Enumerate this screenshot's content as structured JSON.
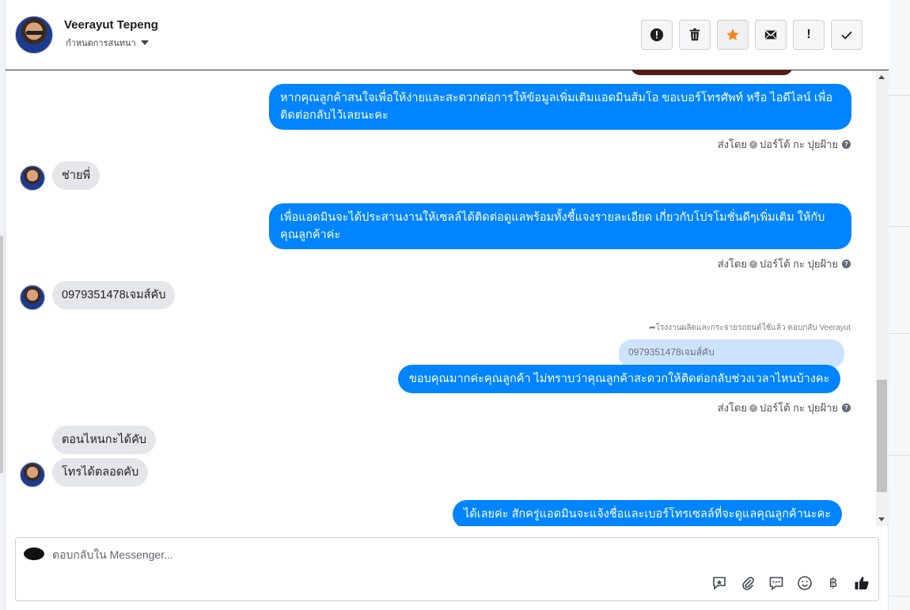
{
  "contact": {
    "name": "Veerayut Tepeng",
    "assign_label": "กำหนดการสนทนา"
  },
  "header_actions": [
    {
      "name": "spam-icon",
      "symbol": "!"
    },
    {
      "name": "trash-icon",
      "symbol": ""
    },
    {
      "name": "star-icon",
      "symbol": "★",
      "color": "#f5821f"
    },
    {
      "name": "mail-icon",
      "symbol": ""
    },
    {
      "name": "follow-up-icon",
      "symbol": "!"
    },
    {
      "name": "done-icon",
      "symbol": ""
    }
  ],
  "messages": [
    {
      "id": "m1",
      "dir": "out",
      "text": "หากคุณลูกค้าสนใจเพื่อให้ง่ายและสะดวกต่อการให้ข้อมูลเพิ่มเติมแอดมินส้มโอ ขอเบอร์โทรศัพท์ หรือ ไอดีไลน์ เพื่อติดต่อกลับไว้เลยนะคะ"
    },
    {
      "id": "m2",
      "dir": "in",
      "text": "ช่ายพี่"
    },
    {
      "id": "m3",
      "dir": "out",
      "text": "เพื่อแอดมินจะได้ประสานงานให้เซลล์ได้ติดต่อดูแลพร้อมทั้งชี้แจงรายละเอียด เกี่ยวกับโปรโมชั่นดีๆเพิ่มเติม ให้กับคุณลูกค้าค่ะ"
    },
    {
      "id": "m4",
      "dir": "in",
      "text": "0979351478เจมส์คับ"
    },
    {
      "id": "m5",
      "dir": "out",
      "text": "ขอบคุณมากค่ะคุณลูกค้า ไม่ทราบว่าคุณลูกค้าสะดวกให้ติดต่อกลับช่วงเวลาไหนบ้างคะ"
    },
    {
      "id": "m6",
      "dir": "in",
      "text": "ตอนไหนกะได้คับ"
    },
    {
      "id": "m7",
      "dir": "in",
      "text": "โทรได้ตลอดคับ"
    },
    {
      "id": "m8",
      "dir": "out",
      "text": "ได้เลยค่ะ สักครู่แอดมินจะแจ้งชื่อและเบอร์โทรเซลล์ที่จะดูแลคุณลูกค้านะคะ"
    }
  ],
  "sent_by": {
    "prefix": "ส่งโดย",
    "sender": "ปอร์โต้ กะ ปุยฝ้าย"
  },
  "reply_meta": "โรงงานผลิตและกระจายรถยนต์ใช้แล้ว ตอบกลับ Veerayut",
  "quoted_text": "0979351478เจมส์คับ",
  "composer": {
    "placeholder": "ตอบกลับใน Messenger...",
    "tools": [
      "saved-reply-icon",
      "attachment-icon",
      "chat-icon",
      "emoji-icon",
      "baht-icon",
      "like-icon"
    ],
    "baht_symbol": "฿"
  },
  "colors": {
    "outgoing_bubble": "#0084ff",
    "incoming_bubble": "#e4e6eb",
    "quoted_bubble": "#cde3fb"
  }
}
